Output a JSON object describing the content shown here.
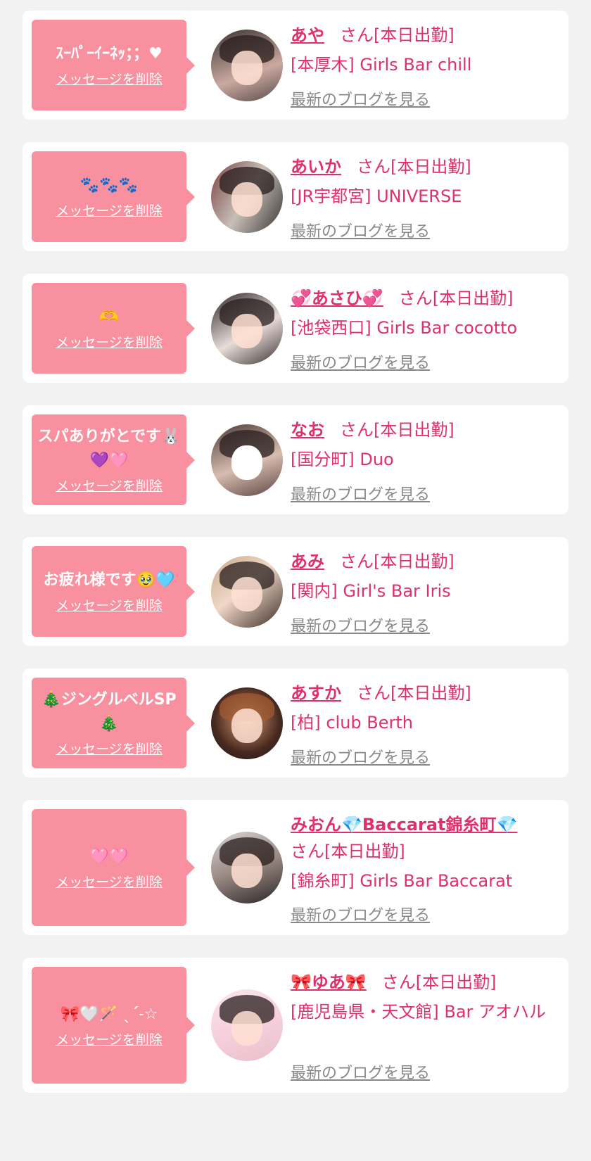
{
  "colors": {
    "accent": "#e0306c",
    "bubble": "#f890a0",
    "link_gray": "#888888",
    "background": "#f2f2f2"
  },
  "delete_label": "メッセージを削除",
  "blog_label": "最新のブログを見る",
  "cards": [
    {
      "message": "ｽｰﾊﾟｰｲｰﾈｯ；；♥",
      "name": "あや",
      "status": "さん[本日出勤]",
      "shop": "[本厚木] Girls Bar chill",
      "avatar": "avatar-photo-aya"
    },
    {
      "message": "🐾🐾🐾",
      "name": "あいか",
      "status": "さん[本日出勤]",
      "shop": "[JR宇都宮] UNIVERSE",
      "avatar": "avatar-photo-aika"
    },
    {
      "message": "🫶",
      "name": "💞あさひ💞",
      "status": "さん[本日出勤]",
      "shop": "[池袋西口] Girls Bar cocotto",
      "avatar": "avatar-photo-asahi"
    },
    {
      "message": "スパありがとです🐰💜🩷",
      "name": "なお",
      "status": "さん[本日出勤]",
      "shop": "[国分町] Duo",
      "avatar": "avatar-photo-nao"
    },
    {
      "message": "お疲れ様です🥹🩵",
      "name": "あみ",
      "status": "さん[本日出勤]",
      "shop": "[関内] Girl's Bar Iris",
      "avatar": "avatar-photo-ami"
    },
    {
      "message": "🎄ジングルベルSP🎄",
      "name": "あすか",
      "status": "さん[本日出勤]",
      "shop": "[柏] club Berth",
      "avatar": "avatar-photo-asuka"
    },
    {
      "message": "🩷🩷",
      "name": "みおん💎Baccarat錦糸町💎",
      "status": "さん[本日出勤]",
      "shop": "[錦糸町] Girls Bar Baccarat",
      "avatar": "avatar-photo-mion"
    },
    {
      "message": "🎀🤍🪄 ˎˊ˗☆",
      "name": "🎀ゆあ🎀",
      "status": "さん[本日出勤]",
      "shop": "[鹿児島県・天文館] Bar アオハル",
      "avatar": "avatar-photo-yua"
    }
  ]
}
